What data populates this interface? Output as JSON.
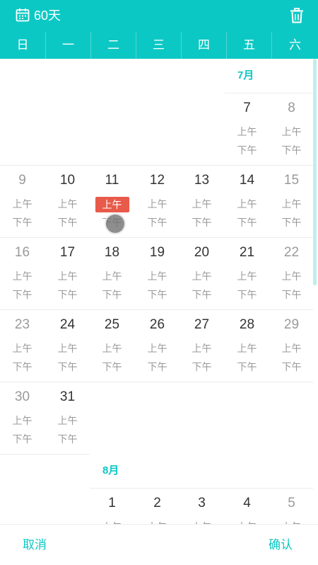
{
  "header": {
    "title": "60天",
    "calendar_icon": "calendar-icon",
    "delete_icon": "trash-icon"
  },
  "weekdays": [
    "日",
    "一",
    "二",
    "三",
    "四",
    "五",
    "六"
  ],
  "slots": {
    "am": "上午",
    "pm": "下午"
  },
  "months": [
    {
      "label": "7月",
      "weeks": [
        [
          null,
          null,
          null,
          null,
          null,
          "7",
          "8"
        ],
        [
          "9",
          "10",
          "11",
          "12",
          "13",
          "14",
          "15"
        ],
        [
          "16",
          "17",
          "18",
          "19",
          "20",
          "21",
          "22"
        ],
        [
          "23",
          "24",
          "25",
          "26",
          "27",
          "28",
          "29"
        ],
        [
          "30",
          "31",
          null,
          null,
          null,
          null,
          null
        ]
      ]
    },
    {
      "label": "8月",
      "weeks": [
        [
          null,
          null,
          "1",
          "2",
          "3",
          "4",
          "5"
        ]
      ]
    }
  ],
  "selected": {
    "month": "7月",
    "day": "11",
    "slot": "上午"
  },
  "colors": {
    "accent": "#0cc8c4",
    "selected": "#e85a4a",
    "weekend": "#9a9a9a",
    "weekday": "#333333"
  },
  "footer": {
    "cancel": "取消",
    "confirm": "确认"
  }
}
